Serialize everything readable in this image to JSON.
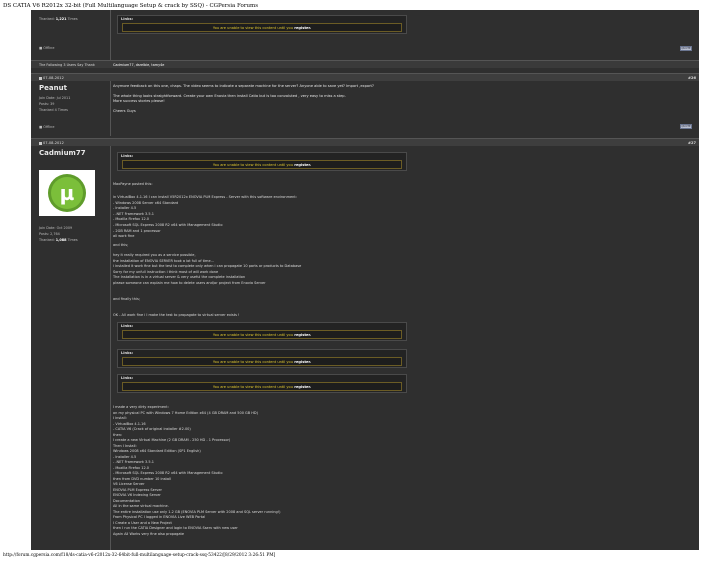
{
  "page_title": "DS CATIA V6 R2012x 32-bit (Full Multilanguage Setup & crack by SSQ) - CGPersia Forums",
  "url_footer": "http://forum.cgpersia.com/f18/ds-catia-v6-r2012x-32-64bit-full-multilanguage-setup-crack-ssq-53422/[8/29/2012 3:26:51 PM]",
  "common": {
    "links_label": "Links:",
    "notice_text": "You are unable to view this content until you ",
    "notice_link": "register.",
    "quote_button": "QUOTE",
    "status_offline": "Offline"
  },
  "post_top": {
    "thanked_label": "Thanked:",
    "thanked_value": "1,221",
    "thanked_suffix": "Times"
  },
  "thanks_row": {
    "label": "The Following 3 Users Say Thank",
    "users": "Cadmium77, dsrelbie, tamy4e"
  },
  "post26": {
    "date": "07-08-2012",
    "number": "#26",
    "username": "Peanut",
    "join_date_label": "Join Date:",
    "join_date": "Jul 2011",
    "posts_label": "Posts:",
    "posts": "39",
    "thanked_label": "Thanked",
    "thanked_value": "4",
    "thanked_suffix": "Times",
    "lines": [
      "Anymore feedback on this one, chaps. The video seems to indicate a separate machine for the server? Anyone able to save yet? Import ,export?",
      "The whole thing looks straightforward. Create your own Enovia then install Catia but is too convoluted , very easy to miss a step.",
      "More success stories please!",
      "Cheers Guys"
    ]
  },
  "post27": {
    "date": "07-08-2012",
    "number": "#27",
    "username": "Cadmium77",
    "join_date_label": "Join Date:",
    "join_date": "Oct 2009",
    "posts_label": "Posts:",
    "posts": "2,764",
    "thanked_label": "Thanked:",
    "thanked_value": "1,088",
    "thanked_suffix": "Times",
    "quote_intro": "MaxPayne posted this:",
    "quote1": [
      "in VirtualBox 4.1.16 I can install V5R2012x ENOVIA PLM Express - Server with this software environment:",
      "- Windows 2008 Server x64 Standard",
      "- Installer 4.5",
      "- .NET Framework 3.5.1",
      "- Mozilla Firefox 12.0",
      "- Microsoft SQL Express 2008 R2 x64 with Management Studio",
      "- 2GB RAM and 1 processor",
      "all work fine"
    ],
    "and_this": "and this;",
    "quote2": [
      "hey it really required you as a service possible,",
      "the installation of ENOVIA SERVER took a lot full of time...",
      "i installed it work fine but the test to complete only when i can propagate 10 parts or products to Database",
      "Sorry for my unfull instruction i think most of will work done",
      "The Installation is in a virtual server & very useful the complete installation",
      "please someone can explain me how to delete users and/or project from Enovia Server"
    ],
    "finally_this": "and finally this;",
    "quote3": "OK - All work fine i I make the test to propagate to virtual server exists !",
    "experiment": [
      "I made a very dirty experiment:",
      "on my physical PC with Windows 7 Home Edition x64 (4 GB DRAM and 500 GB HD)",
      "I install:",
      "- VirtualBox 4.1.16",
      "- CATIA V6 (Crack of original installer #2.00)",
      "then:",
      "I create a new Virtual Machine (2 GB DRAM - 250 HD - 1 Processor)",
      "Then I Install:",
      "Windows 2008 x64 Standard Edition (SP1 English)",
      "- Installer 4.5",
      "- .NET Framework 3.5.1",
      "- Mozilla Firefox 12.0",
      "- Microsoft SQL Express 2008 R2 x64 with Management Studio",
      "then from DVD number 10 install",
      "V6 License Server",
      "ENOVIA PLM Express Server",
      "ENOVIA V6 Indexing Server",
      "Documentation",
      "All in the same virtual machine.",
      "The entire installation use only 1.2 GB (ENOVIA PLM Server with 2008 and SQL server running!)",
      "From Physical PC I logged in ENOVIA Live WEB Portal",
      "I Create a User and a New Project",
      "then I run the CATIA Designer and login to ENOVIA Sserv with new user",
      "Again All Works very fine also propagate"
    ]
  }
}
